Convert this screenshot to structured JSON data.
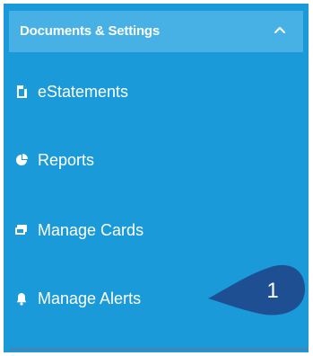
{
  "section": {
    "title": "Documents & Settings",
    "expanded_icon": "chevron-up-icon"
  },
  "menu": {
    "items": [
      {
        "label": "eStatements",
        "icon": "document-icon"
      },
      {
        "label": "Reports",
        "icon": "pie-chart-icon"
      },
      {
        "label": "Manage Cards",
        "icon": "cards-icon"
      },
      {
        "label": "Manage Alerts",
        "icon": "bell-icon"
      }
    ]
  },
  "callout": {
    "number": "1"
  },
  "colors": {
    "panel": "#1a9ad8",
    "header": "#47b1e6",
    "callout": "#1f4f93",
    "text": "#ffffff"
  }
}
